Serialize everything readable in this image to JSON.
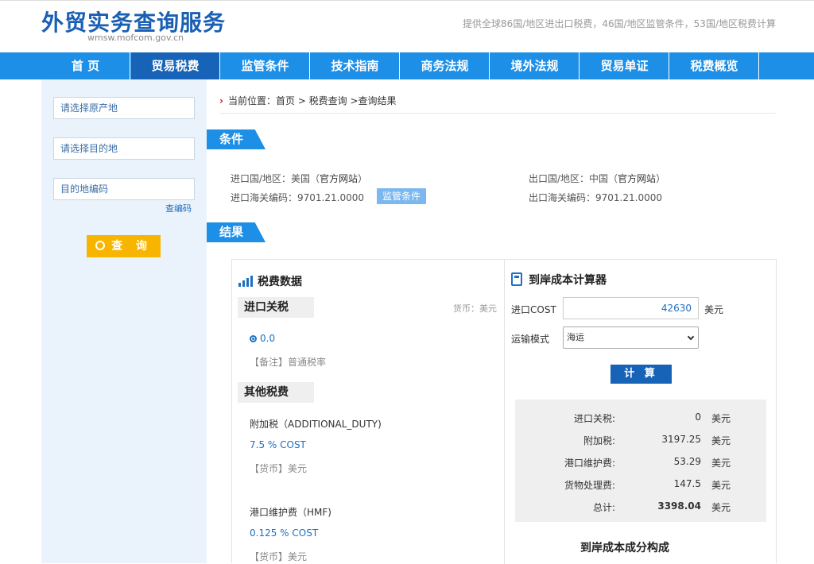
{
  "header": {
    "title": "外贸实务查询服务",
    "subtitle": "wmsw.mofcom.gov.cn",
    "slogan": "提供全球86国/地区进出口税费，46国/地区监管条件，53国/地区税费计算"
  },
  "nav": {
    "items": [
      "首 页",
      "贸易税费",
      "监管条件",
      "技术指南",
      "商务法规",
      "境外法规",
      "贸易单证",
      "税费概览"
    ],
    "active_index": 1
  },
  "sidebar": {
    "origin_placeholder": "请选择原产地",
    "destination_placeholder": "请选择目的地",
    "dest_code_placeholder": "目的地编码",
    "lookup_code_link": "查编码",
    "query_button": "查 询"
  },
  "breadcrumb": {
    "prefix": "当前位置：",
    "path": "首页 > 税费查询 >查询结果"
  },
  "conditions": {
    "tag": "条件",
    "import_country_label": "进口国/地区：美国（",
    "import_country_link": "官方网站",
    "import_country_suffix": "）",
    "export_country_label": "出口国/地区：中国（",
    "export_country_link": "官方网站",
    "export_country_suffix": "）",
    "import_code": "进口海关编码：9701.21.0000",
    "export_code": "出口海关编码：9701.21.0000",
    "supervision_badge": "监管条件"
  },
  "results": {
    "tag": "结果",
    "tax_data": {
      "title": "税费数据",
      "import_duty_header": "进口关税",
      "currency_note": "货币：美元",
      "duty_value": "0.0",
      "duty_remark": "【备注】普通税率",
      "other_taxes_header": "其他税费",
      "items": [
        {
          "name": "附加税（ADDITIONAL_DUTY)",
          "rate": "7.5 % COST",
          "currency": "【货币】美元"
        },
        {
          "name": "港口维护费（HMF)",
          "rate": "0.125 % COST",
          "currency": "【货币】美元"
        }
      ]
    },
    "calculator": {
      "title": "到岸成本计算器",
      "cost_label": "进口COST",
      "cost_value": "42630",
      "cost_unit": "美元",
      "transport_label": "运输模式",
      "transport_selected": "海运",
      "calc_button": "计 算",
      "rows": [
        {
          "label": "进口关税:",
          "value": "0",
          "unit": "美元"
        },
        {
          "label": "附加税:",
          "value": "3197.25",
          "unit": "美元"
        },
        {
          "label": "港口维护费:",
          "value": "53.29",
          "unit": "美元"
        },
        {
          "label": "货物处理费:",
          "value": "147.5",
          "unit": "美元"
        },
        {
          "label": "总计:",
          "value": "3398.04",
          "unit": "美元"
        }
      ],
      "composition_title": "到岸成本成分构成"
    }
  },
  "colors": {
    "nav_blue": "#1e8fe6",
    "nav_active": "#1763b8",
    "query_button": "#f8b500",
    "link_blue": "#1e6fc2"
  }
}
